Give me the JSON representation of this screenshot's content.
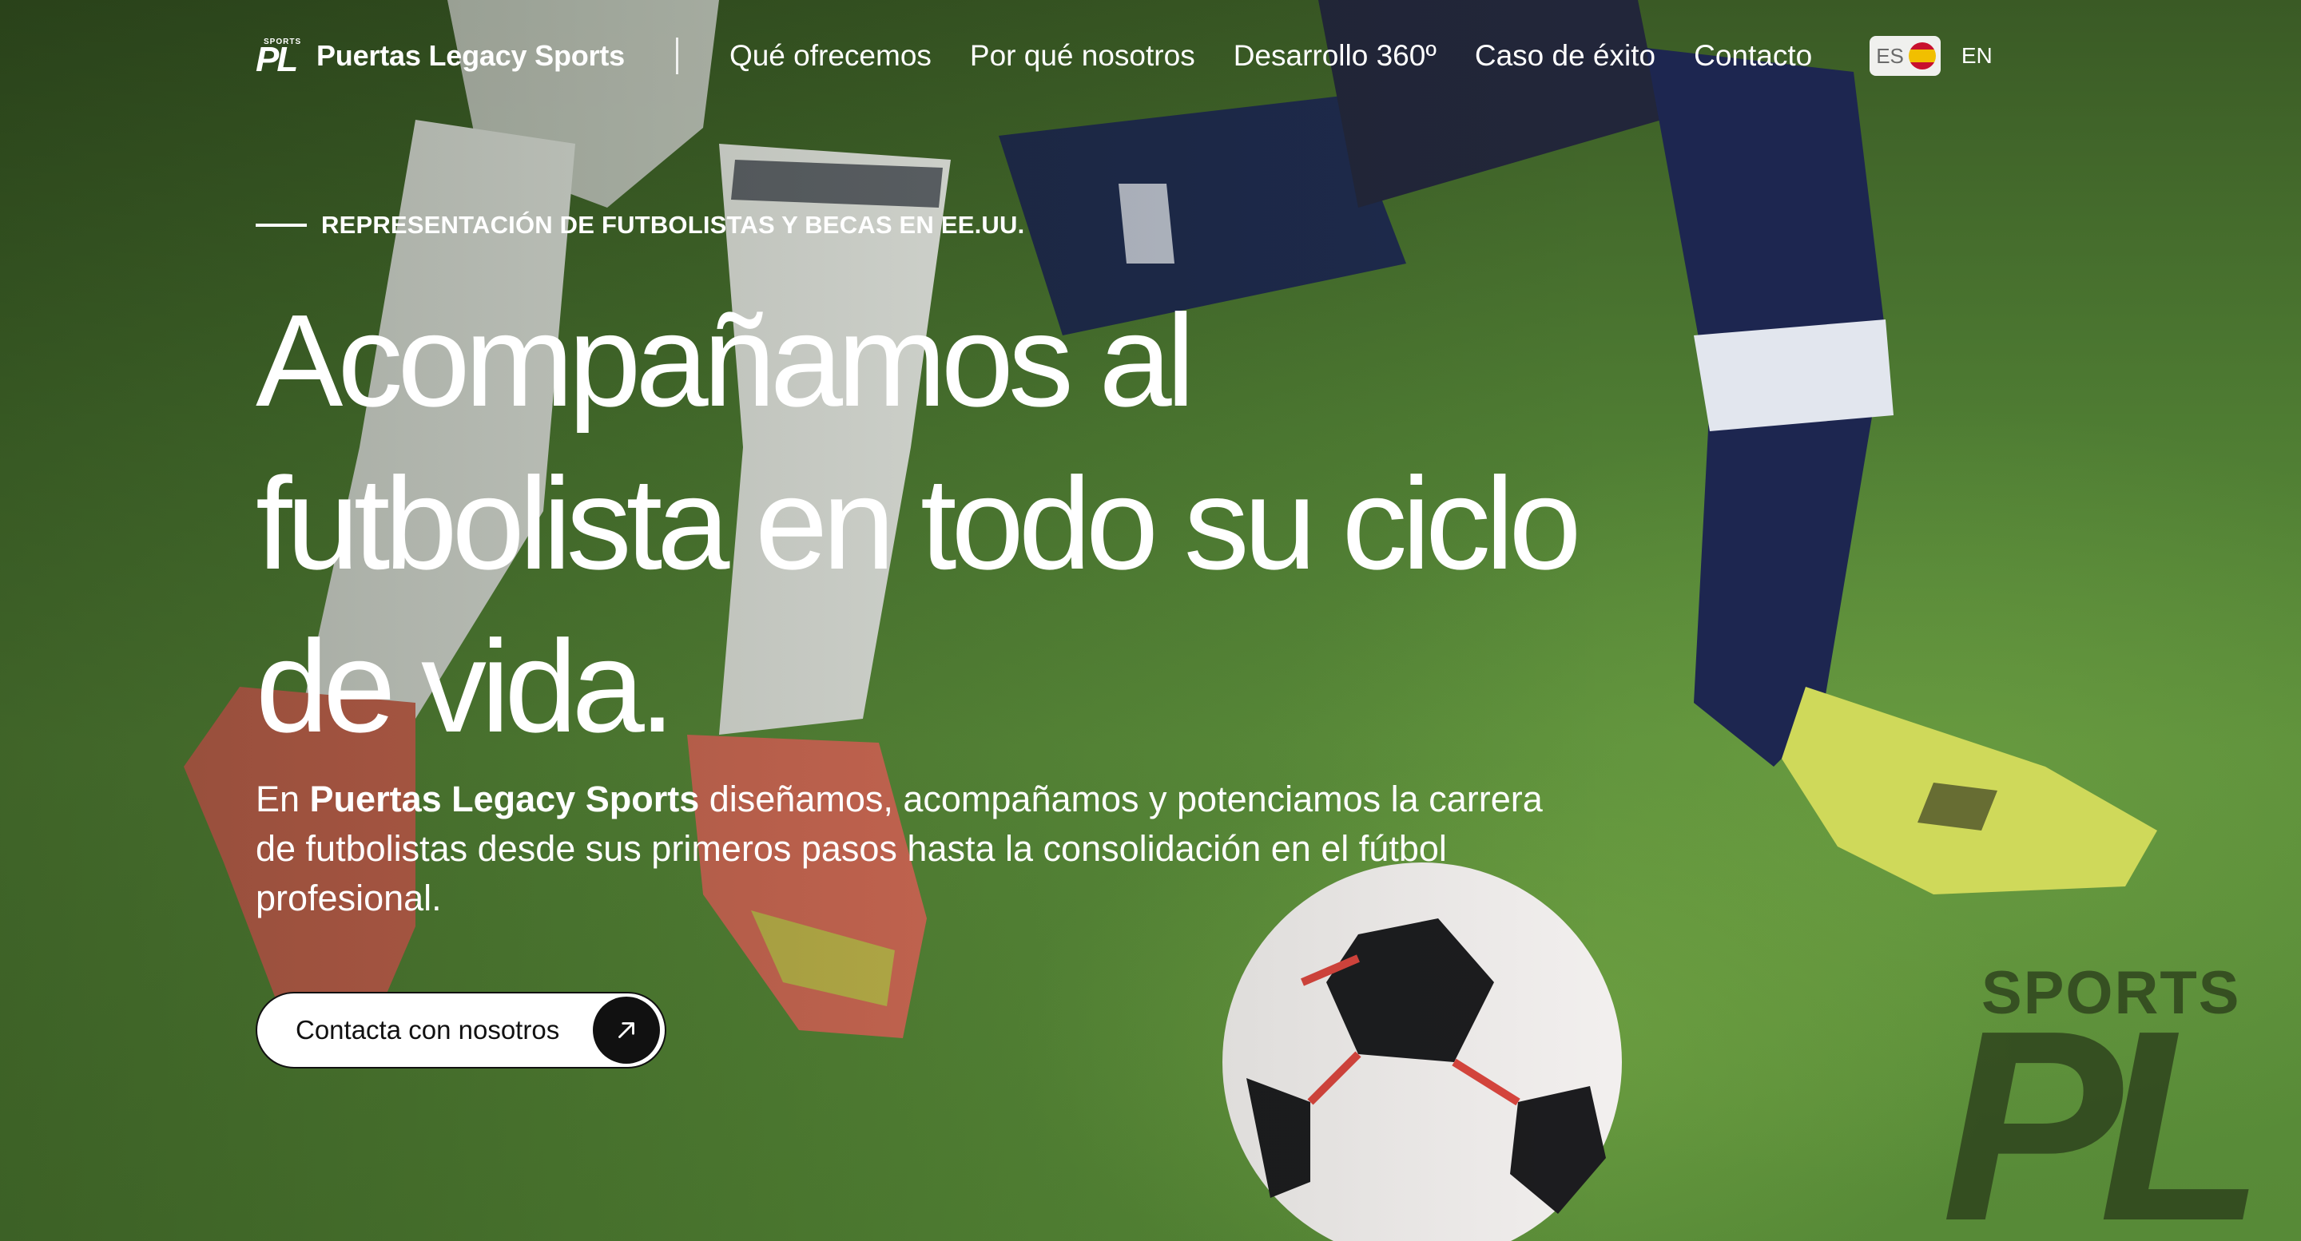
{
  "header": {
    "brand_small": "SPORTS",
    "brand_mark": "PL",
    "brand_name": "Puertas Legacy Sports",
    "nav": [
      {
        "label": "Qué ofrecemos"
      },
      {
        "label": "Por qué nosotros"
      },
      {
        "label": "Desarrollo 360º"
      },
      {
        "label": "Caso de éxito"
      },
      {
        "label": "Contacto"
      }
    ],
    "lang": {
      "es": "ES",
      "en": "EN",
      "active": "ES"
    }
  },
  "hero": {
    "eyebrow": "REPRESENTACIÓN DE FUTBOLISTAS Y BECAS EN EE.UU.",
    "headline": "Acompañamos al futbolista en todo su ciclo de vida.",
    "lead_prefix": "En ",
    "lead_brand": "Puertas Legacy Sports",
    "lead_rest": " diseñamos, acompañamos y potenciamos la carrera de futbolistas desde sus primeros pasos hasta la consolidación en el fútbol profesional.",
    "cta_label": "Contacta con nosotros",
    "cta_icon": "arrow-up-right-icon"
  },
  "watermark": {
    "top": "SPORTS",
    "big": "PL"
  },
  "colors": {
    "accent": "#111111",
    "field_green": "#5c8f3b",
    "text": "#ffffff"
  }
}
